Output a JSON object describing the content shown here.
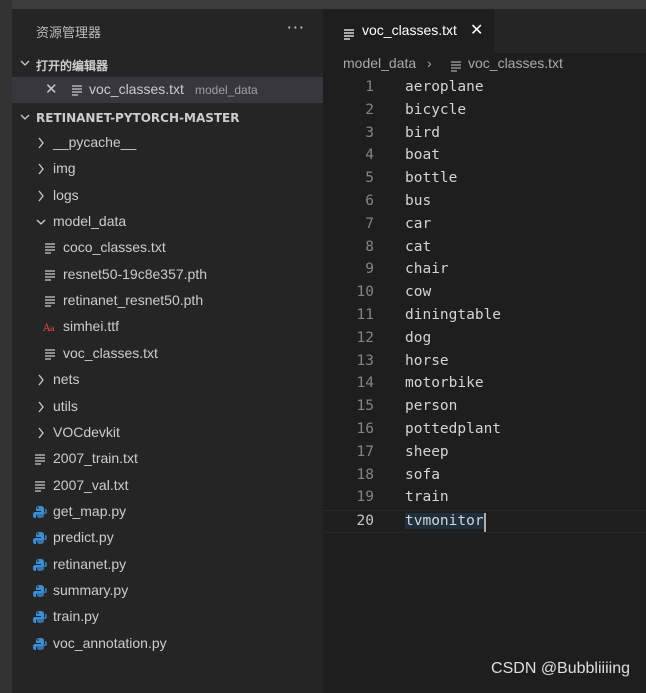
{
  "explorer": {
    "title": "资源管理器",
    "more_label": "···",
    "open_editors": {
      "heading": "打开的编辑器",
      "items": [
        {
          "name": "voc_classes.txt",
          "folder": "model_data",
          "icon": "file-lines-icon"
        }
      ]
    },
    "project": {
      "heading": "RETINANET-PYTORCH-MASTER",
      "tree": [
        {
          "label": "__pycache__",
          "type": "folder"
        },
        {
          "label": "img",
          "type": "folder"
        },
        {
          "label": "logs",
          "type": "folder"
        },
        {
          "label": "model_data",
          "type": "folder-open"
        },
        {
          "label": "coco_classes.txt",
          "type": "file-text"
        },
        {
          "label": "resnet50-19c8e357.pth",
          "type": "file-text"
        },
        {
          "label": "retinanet_resnet50.pth",
          "type": "file-text"
        },
        {
          "label": "simhei.ttf",
          "type": "file-font"
        },
        {
          "label": "voc_classes.txt",
          "type": "file-text"
        },
        {
          "label": "nets",
          "type": "folder"
        },
        {
          "label": "utils",
          "type": "folder"
        },
        {
          "label": "VOCdevkit",
          "type": "folder"
        },
        {
          "label": "2007_train.txt",
          "type": "file-text"
        },
        {
          "label": "2007_val.txt",
          "type": "file-text"
        },
        {
          "label": "get_map.py",
          "type": "file-python"
        },
        {
          "label": "predict.py",
          "type": "file-python"
        },
        {
          "label": "retinanet.py",
          "type": "file-python"
        },
        {
          "label": "summary.py",
          "type": "file-python"
        },
        {
          "label": "train.py",
          "type": "file-python"
        },
        {
          "label": "voc_annotation.py",
          "type": "file-python"
        }
      ]
    }
  },
  "editor": {
    "tab": {
      "label": "voc_classes.txt",
      "close": "✕"
    },
    "breadcrumb": {
      "folder": "model_data",
      "separator": "›",
      "file": "voc_classes.txt"
    },
    "lines": [
      "aeroplane",
      "bicycle",
      "bird",
      "boat",
      "bottle",
      "bus",
      "car",
      "cat",
      "chair",
      "cow",
      "diningtable",
      "dog",
      "horse",
      "motorbike",
      "person",
      "pottedplant",
      "sheep",
      "sofa",
      "train",
      "tvmonitor"
    ],
    "line_numbers": [
      "1",
      "2",
      "3",
      "4",
      "5",
      "6",
      "7",
      "8",
      "9",
      "10",
      "11",
      "12",
      "13",
      "14",
      "15",
      "16",
      "17",
      "18",
      "19",
      "20"
    ],
    "current_line": 20
  },
  "watermark": "CSDN @Bubbliiiing",
  "colors": {
    "python_icon": "#3b8fd6",
    "font_icon": "#e04b4b",
    "selection": "#264f78"
  }
}
